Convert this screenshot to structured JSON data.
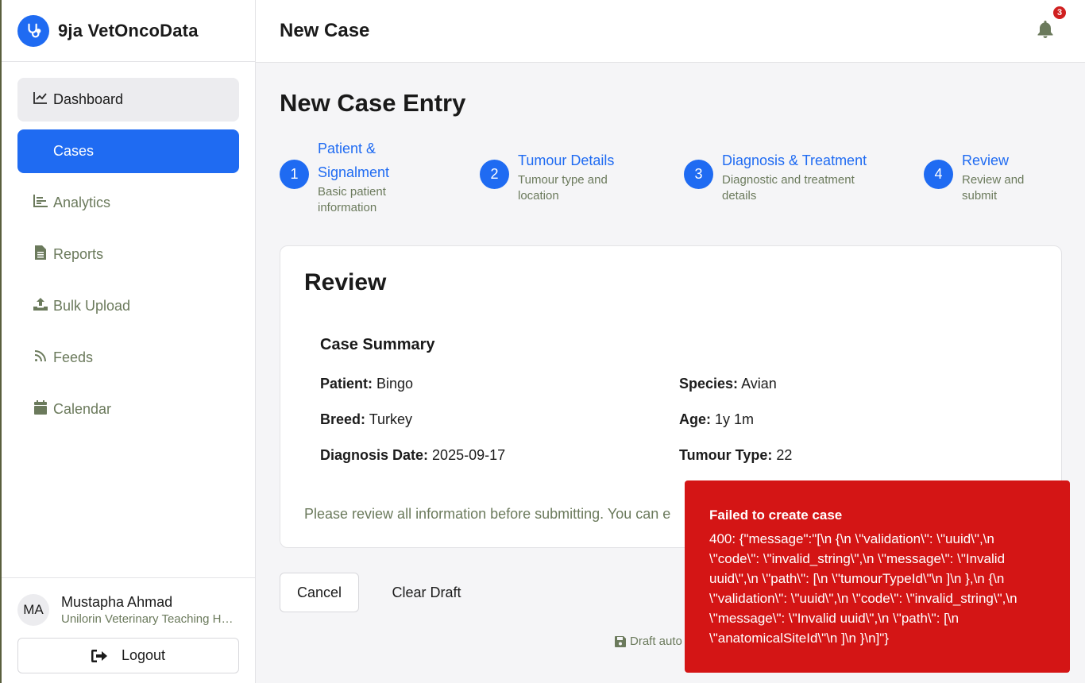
{
  "app": {
    "name": "9ja VetOncoData"
  },
  "sidebar": {
    "items": [
      {
        "label": "Dashboard",
        "icon": "chart-line-icon"
      },
      {
        "label": "Cases",
        "icon": "folder-icon"
      },
      {
        "label": "Analytics",
        "icon": "bar-chart-icon"
      },
      {
        "label": "Reports",
        "icon": "file-icon"
      },
      {
        "label": "Bulk Upload",
        "icon": "upload-icon"
      },
      {
        "label": "Feeds",
        "icon": "rss-icon"
      },
      {
        "label": "Calendar",
        "icon": "calendar-icon"
      }
    ],
    "active": "Cases",
    "hovered": "Dashboard"
  },
  "user": {
    "initials": "MA",
    "name": "Mustapha Ahmad",
    "org": "Unilorin Veterinary Teaching Hospital"
  },
  "logout_label": "Logout",
  "header": {
    "title": "New Case",
    "notification_count": "3"
  },
  "page_title": "New Case Entry",
  "steps": [
    {
      "num": "1",
      "title_line1": "Patient &",
      "title_line2": "Signalment",
      "desc_line1": "Basic patient",
      "desc_line2": "information"
    },
    {
      "num": "2",
      "title": "Tumour Details",
      "desc_line1": "Tumour type and",
      "desc_line2": "location"
    },
    {
      "num": "3",
      "title": "Diagnosis & Treatment",
      "desc_line1": "Diagnostic and treatment",
      "desc_line2": "details"
    },
    {
      "num": "4",
      "title": "Review",
      "desc_line1": "Review and",
      "desc_line2": "submit"
    }
  ],
  "review": {
    "title": "Review",
    "summary_title": "Case Summary",
    "fields": {
      "patient": {
        "label": "Patient:",
        "value": "Bingo"
      },
      "species": {
        "label": "Species:",
        "value": "Avian"
      },
      "breed": {
        "label": "Breed:",
        "value": "Turkey"
      },
      "age": {
        "label": "Age:",
        "value": "1y 1m"
      },
      "diagnosis_date": {
        "label": "Diagnosis Date:",
        "value": "2025-09-17"
      },
      "tumour_type": {
        "label": "Tumour Type:",
        "value": "22"
      }
    },
    "note": "Please review all information before submitting. You can e"
  },
  "actions": {
    "cancel": "Cancel",
    "clear_draft": "Clear Draft"
  },
  "autosave_text": "Draft auto",
  "toast": {
    "title": "Failed to create case",
    "message": "400: {\"message\":\"[\\n {\\n \\\"validation\\\": \\\"uuid\\\",\\n \\\"code\\\": \\\"invalid_string\\\",\\n \\\"message\\\": \\\"Invalid uuid\\\",\\n \\\"path\\\": [\\n \\\"tumourTypeId\\\"\\n ]\\n },\\n {\\n \\\"validation\\\": \\\"uuid\\\",\\n \\\"code\\\": \\\"invalid_string\\\",\\n \\\"message\\\": \\\"Invalid uuid\\\",\\n \\\"path\\\": [\\n \\\"anatomicalSiteId\\\"\\n ]\\n }\\n]\"}"
  },
  "colors": {
    "primary": "#1f6bf2",
    "error": "#d41515",
    "muted": "#6b7a5c"
  }
}
